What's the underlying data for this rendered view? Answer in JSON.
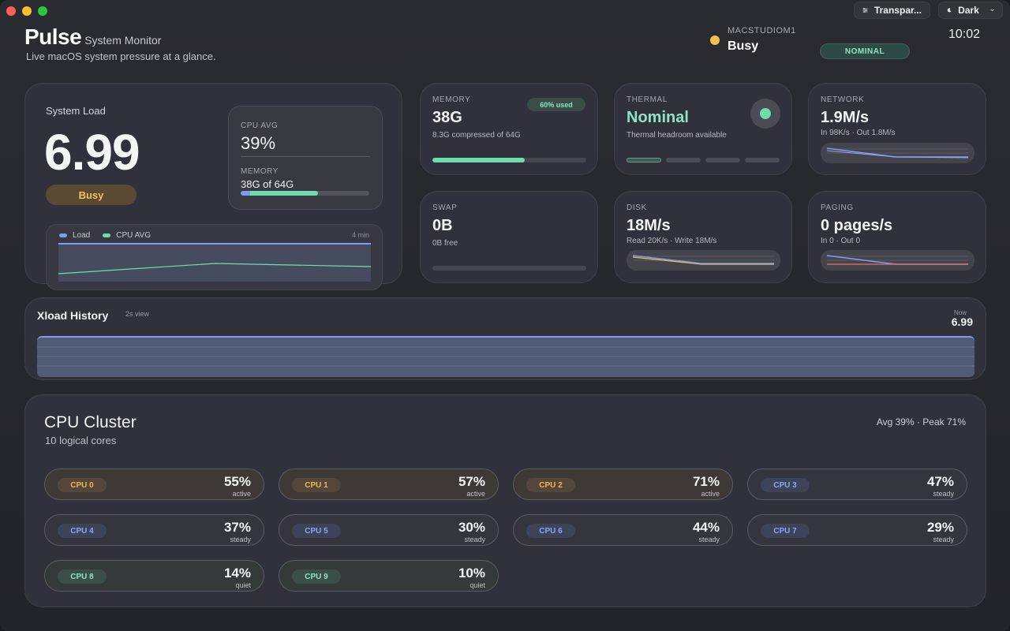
{
  "app": {
    "name": "Pulse",
    "subtitle_small": "System Monitor",
    "tagline": "Live macOS system pressure at a glance."
  },
  "toolbar": {
    "transparency_label": "Transpar...",
    "theme_label": "Dark"
  },
  "host": {
    "name": "MACSTUDIOM1",
    "status": "Busy",
    "status_color": "#f3c04e",
    "thermal_pill": "NOMINAL"
  },
  "clock": "10:02",
  "system_load": {
    "heading": "System Load",
    "value": "6.99",
    "state": "Busy",
    "cpu_avg_label": "CPU AVG",
    "cpu_avg_value": "39%",
    "memory_label": "MEMORY",
    "memory_value": "38G of 64G",
    "memory_fraction": 0.6,
    "chart": {
      "legend_load": "Load",
      "legend_cpu": "CPU AVG",
      "range": "4 min",
      "load_color": "#7f9cf5",
      "cpu_color": "#6fdcb0"
    }
  },
  "memory": {
    "label": "MEMORY",
    "value": "38G",
    "pill": "60% used",
    "detail": "8.3G compressed of 64G",
    "fraction": 0.6
  },
  "thermal": {
    "label": "THERMAL",
    "value": "Nominal",
    "detail": "Thermal headroom available",
    "level": 1,
    "levels": 4
  },
  "network": {
    "label": "NETWORK",
    "value": "1.9M/s",
    "detail": "In 98K/s · Out 1.8M/s"
  },
  "swap": {
    "label": "SWAP",
    "value": "0B",
    "detail": "0B free"
  },
  "disk": {
    "label": "DISK",
    "value": "18M/s",
    "detail": "Read 20K/s · Write 18M/s"
  },
  "paging": {
    "label": "PAGING",
    "value": "0 pages/s",
    "detail": "In 0 · Out 0"
  },
  "history": {
    "title": "Xload History",
    "view": "2s view",
    "now_label": "Now",
    "now_value": "6.99"
  },
  "cluster": {
    "title": "CPU Cluster",
    "subtitle": "10 logical cores",
    "stats": "Avg 39% · Peak 71%",
    "cores": [
      {
        "name": "CPU 0",
        "pct": "55%",
        "state": "active"
      },
      {
        "name": "CPU 1",
        "pct": "57%",
        "state": "active"
      },
      {
        "name": "CPU 2",
        "pct": "71%",
        "state": "active"
      },
      {
        "name": "CPU 3",
        "pct": "47%",
        "state": "steady"
      },
      {
        "name": "CPU 4",
        "pct": "37%",
        "state": "steady"
      },
      {
        "name": "CPU 5",
        "pct": "30%",
        "state": "steady"
      },
      {
        "name": "CPU 6",
        "pct": "44%",
        "state": "steady"
      },
      {
        "name": "CPU 7",
        "pct": "29%",
        "state": "steady"
      },
      {
        "name": "CPU 8",
        "pct": "14%",
        "state": "quiet"
      },
      {
        "name": "CPU 9",
        "pct": "10%",
        "state": "quiet"
      }
    ]
  }
}
